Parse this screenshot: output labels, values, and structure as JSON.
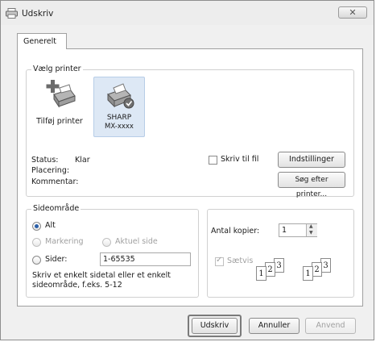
{
  "window": {
    "title": "Udskriv"
  },
  "tabs": [
    {
      "label": "Generelt"
    }
  ],
  "select_printer": {
    "legend": "Vælg printer",
    "printers": [
      {
        "label": "Tilføj printer"
      },
      {
        "label_line1": "SHARP",
        "label_line2": "MX-xxxx"
      }
    ],
    "status_label": "Status:",
    "status_value": "Klar",
    "location_label": "Placering:",
    "comment_label": "Kommentar:",
    "print_to_file_label": "Skriv til fil",
    "settings_button": "Indstillinger",
    "find_printer_button": "Søg efter printer..."
  },
  "page_range": {
    "legend": "Sideområde",
    "all_label": "Alt",
    "selection_label": "Markering",
    "current_page_label": "Aktuel side",
    "pages_label": "Sider:",
    "pages_value": "1-65535",
    "help_line1": "Skriv et enkelt sidetal eller et enkelt",
    "help_line2": "sideområde, f.eks. 5-12"
  },
  "copies": {
    "label": "Antal kopier:",
    "value": "1",
    "collate_label": "Sætvis",
    "collate_digits": [
      "1",
      "2",
      "3"
    ]
  },
  "footer": {
    "print_button": "Udskriv",
    "cancel_button": "Annuller",
    "apply_button": "Anvend"
  },
  "icons": [
    "printer-icon",
    "add-printer-icon",
    "sharp-printer-icon",
    "close-icon",
    "spinner-up-icon",
    "spinner-down-icon"
  ]
}
